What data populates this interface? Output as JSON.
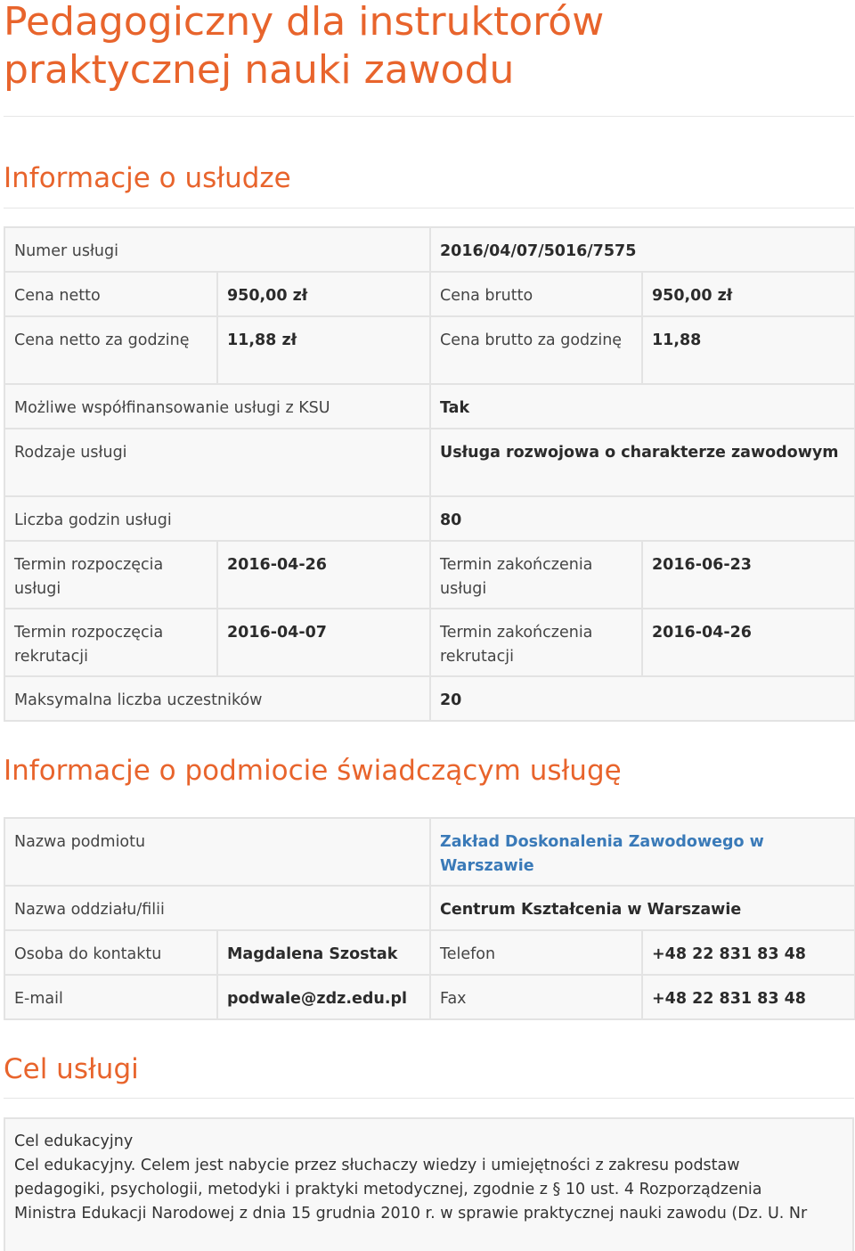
{
  "title_line1": "Pedagogiczny dla instruktorów",
  "title_line2": "praktycznej nauki zawodu",
  "service": {
    "heading": "Informacje o usłudze",
    "number_label": "Numer usługi",
    "number_value": "2016/04/07/5016/7575",
    "net_label": "Cena netto",
    "net_value": "950,00 zł",
    "gross_label": "Cena brutto",
    "gross_value": "950,00 zł",
    "net_hour_label": "Cena netto za godzinę",
    "net_hour_value": "11,88 zł",
    "gross_hour_label": "Cena brutto za godzinę",
    "gross_hour_value": "11,88",
    "cofin_label": "Możliwe współfinansowanie usługi z KSU",
    "cofin_value": "Tak",
    "type_label": "Rodzaje usługi",
    "type_value": "Usługa rozwojowa o charakterze zawodowym",
    "hours_label": "Liczba godzin usługi",
    "hours_value": "80",
    "start_label": "Termin rozpoczęcia usługi",
    "start_value": "2016-04-26",
    "end_label": "Termin zakończenia usługi",
    "end_value": "2016-06-23",
    "rec_start_label": "Termin rozpoczęcia rekrutacji",
    "rec_start_value": "2016-04-07",
    "rec_end_label": "Termin zakończenia rekrutacji",
    "rec_end_value": "2016-04-26",
    "max_label": "Maksymalna liczba uczestników",
    "max_value": "20"
  },
  "provider": {
    "heading": "Informacje o podmiocie świadczącym usługę",
    "name_label": "Nazwa podmiotu",
    "name_value": "Zakład Doskonalenia Zawodowego w Warszawie",
    "branch_label": "Nazwa oddziału/filii",
    "branch_value": "Centrum Kształcenia w Warszawie",
    "contact_label": "Osoba do kontaktu",
    "contact_value": "Magdalena Szostak",
    "phone_label": "Telefon",
    "phone_value": "+48 22 831 83 48",
    "email_label": "E-mail",
    "email_value": "podwale@zdz.edu.pl",
    "fax_label": "Fax",
    "fax_value": "+48 22 831 83 48"
  },
  "goal": {
    "heading": "Cel usługi",
    "type_label": "Cel edukacyjny",
    "line1": "Cel edukacyjny. Celem jest nabycie przez słuchaczy wiedzy i umiejętności z zakresu podstaw",
    "line2": "pedagogiki, psychologii, metodyki i praktyki metodycznej, zgodnie z § 10 ust. 4 Rozporządzenia",
    "line3": "Ministra Edukacji Narodowej z dnia 15 grudnia 2010 r. w sprawie praktycznej nauki zawodu (Dz. U. Nr"
  },
  "colors": {
    "accent": "#e8642c",
    "link": "#3a7ab8",
    "table_bg": "#f8f8f8",
    "border": "#e3e3e3"
  }
}
